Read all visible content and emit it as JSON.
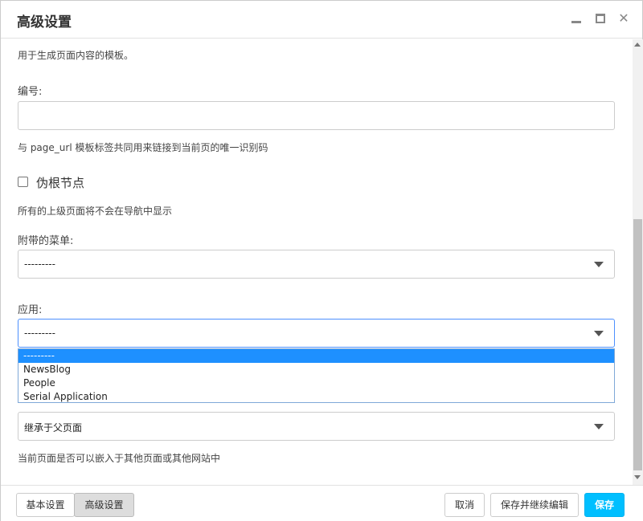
{
  "window": {
    "title": "高级设置",
    "controls": {
      "minimize_icon": "minimize-icon",
      "maximize_icon": "maximize-icon",
      "close_icon": "close-icon",
      "close_glyph": "✕"
    }
  },
  "form": {
    "template_help": "用于生成页面内容的模板。",
    "id_field": {
      "label": "编号:",
      "value": "",
      "help": "与 page_url 模板标签共同用来链接到当前页的唯一识别码"
    },
    "soft_root": {
      "label": "伪根节点",
      "checked": false,
      "help": "所有的上级页面将不会在导航中显示"
    },
    "menu_field": {
      "label": "附带的菜单:",
      "value": "---------"
    },
    "app_field": {
      "label": "应用:",
      "value": "---------",
      "options": [
        "---------",
        "NewsBlog",
        "People",
        "Serial Application"
      ],
      "selected_index": 0
    },
    "xframe_field": {
      "value": "继承于父页面",
      "help": "当前页面是否可以嵌入于其他页面或其他网站中"
    }
  },
  "footer": {
    "tab_basic": "基本设置",
    "tab_advanced": "高级设置",
    "cancel": "取消",
    "save_continue": "保存并继续编辑",
    "save": "保存"
  },
  "colors": {
    "primary": "#00bfff",
    "selected_option": "#1e90ff",
    "focus_border": "#4d90fe"
  }
}
